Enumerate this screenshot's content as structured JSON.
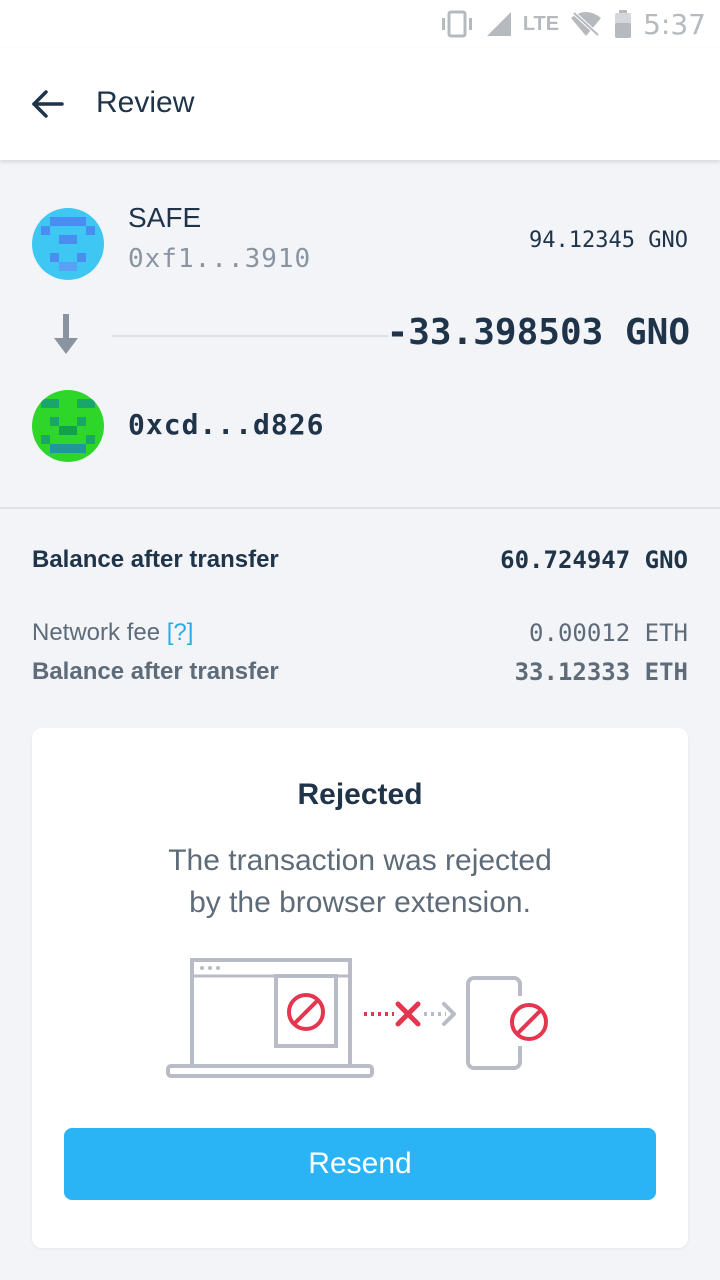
{
  "status_bar": {
    "network": "LTE",
    "time": "5:37"
  },
  "app_bar": {
    "title": "Review"
  },
  "transfer": {
    "from": {
      "name": "SAFE",
      "address": "0xf1...3910",
      "balance": "94.12345 GNO"
    },
    "amount": "-33.398503 GNO",
    "to": {
      "address": "0xcd...d826"
    }
  },
  "summary": {
    "balance_after_label": "Balance after transfer",
    "balance_after_value": "60.724947 GNO",
    "network_fee_label": "Network fee",
    "network_fee_help": "[?]",
    "network_fee_value": "0.00012 ETH",
    "eth_balance_label": "Balance after transfer",
    "eth_balance_value": "33.12333 ETH"
  },
  "rejected_card": {
    "title": "Rejected",
    "message_line1": "The transaction was rejected",
    "message_line2": "by the browser extension.",
    "button_label": "Resend"
  },
  "colors": {
    "accent": "#2bb4f5",
    "text_dark": "#1f3349",
    "reject_red": "#e5364f",
    "illustration_gray": "#b9bcc6"
  }
}
